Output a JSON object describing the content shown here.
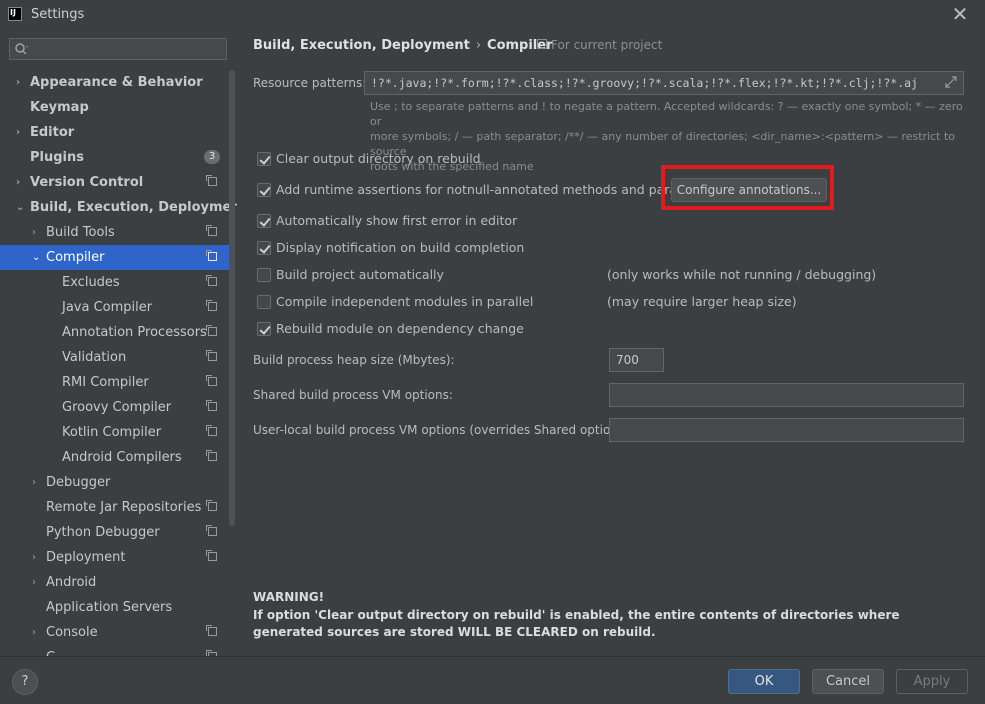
{
  "window": {
    "title": "Settings",
    "close_glyph": "✕"
  },
  "search": {
    "placeholder": "",
    "value": ""
  },
  "sidebar": {
    "items": [
      {
        "label": "Appearance & Behavior",
        "arrow": "›",
        "bold": true
      },
      {
        "label": "Keymap",
        "bold": true
      },
      {
        "label": "Editor",
        "arrow": "›",
        "bold": true
      },
      {
        "label": "Plugins",
        "bold": true,
        "badge": "3"
      },
      {
        "label": "Version Control",
        "arrow": "›",
        "bold": true,
        "icon": "project-icon"
      },
      {
        "label": "Build, Execution, Deployment",
        "arrow": "⌄",
        "bold": true
      },
      {
        "label": "Build Tools",
        "arrow": "›",
        "icon": "project-icon"
      },
      {
        "label": "Compiler",
        "arrow": "⌄",
        "icon": "project-icon",
        "selected": true
      },
      {
        "label": "Excludes",
        "icon": "project-icon"
      },
      {
        "label": "Java Compiler",
        "icon": "project-icon"
      },
      {
        "label": "Annotation Processors",
        "icon": "project-icon"
      },
      {
        "label": "Validation",
        "icon": "project-icon"
      },
      {
        "label": "RMI Compiler",
        "icon": "project-icon"
      },
      {
        "label": "Groovy Compiler",
        "icon": "project-icon"
      },
      {
        "label": "Kotlin Compiler",
        "icon": "project-icon"
      },
      {
        "label": "Android Compilers",
        "icon": "project-icon"
      },
      {
        "label": "Debugger",
        "arrow": "›"
      },
      {
        "label": "Remote Jar Repositories",
        "icon": "project-icon"
      },
      {
        "label": "Python Debugger",
        "icon": "project-icon"
      },
      {
        "label": "Deployment",
        "arrow": "›",
        "icon": "project-icon"
      },
      {
        "label": "Android",
        "arrow": "›"
      },
      {
        "label": "Application Servers"
      },
      {
        "label": "Console",
        "arrow": "›",
        "icon": "project-icon"
      },
      {
        "label": "C...",
        "icon": "project-icon"
      }
    ]
  },
  "breadcrumb": {
    "parent": "Build, Execution, Deployment",
    "separator": "›",
    "current": "Compiler"
  },
  "scope_note": "For current project",
  "resource_patterns": {
    "label": "Resource patterns:",
    "value": "!?*.java;!?*.form;!?*.class;!?*.groovy;!?*.scala;!?*.flex;!?*.kt;!?*.clj;!?*.aj",
    "hint_line1": "Use ; to separate patterns and ! to negate a pattern. Accepted wildcards: ? — exactly one symbol; * — zero or",
    "hint_line2": "more symbols; / — path separator; /**/ — any number of directories; <dir_name>:<pattern> — restrict to source",
    "hint_line3": "roots with the specified name"
  },
  "options": [
    {
      "label": "Clear output directory on rebuild",
      "checked": true
    },
    {
      "label": "Add runtime assertions for notnull-annotated methods and parameters",
      "checked": true
    },
    {
      "label": "Automatically show first error in editor",
      "checked": true
    },
    {
      "label": "Display notification on build completion",
      "checked": true
    },
    {
      "label": "Build project automatically",
      "checked": false,
      "note": "(only works while not running / debugging)"
    },
    {
      "label": "Compile independent modules in parallel",
      "checked": false,
      "note": "(may require larger heap size)"
    },
    {
      "label": "Rebuild module on dependency change",
      "checked": true
    }
  ],
  "configure_button": "Configure annotations...",
  "heap": {
    "label": "Build process heap size (Mbytes):",
    "value": "700"
  },
  "shared_vm": {
    "label": "Shared build process VM options:",
    "value": ""
  },
  "user_vm": {
    "label": "User-local build process VM options (overrides Shared options):",
    "value": ""
  },
  "warning": {
    "title": "WARNING!",
    "text": "If option 'Clear output directory on rebuild' is enabled, the entire contents of directories where generated sources are stored WILL BE CLEARED on rebuild."
  },
  "footer": {
    "help": "?",
    "ok": "OK",
    "cancel": "Cancel",
    "apply": "Apply"
  },
  "colors": {
    "accent_selected": "#2f65ca",
    "highlight_annotation": "#e31b1b",
    "ok_button": "#365880"
  }
}
